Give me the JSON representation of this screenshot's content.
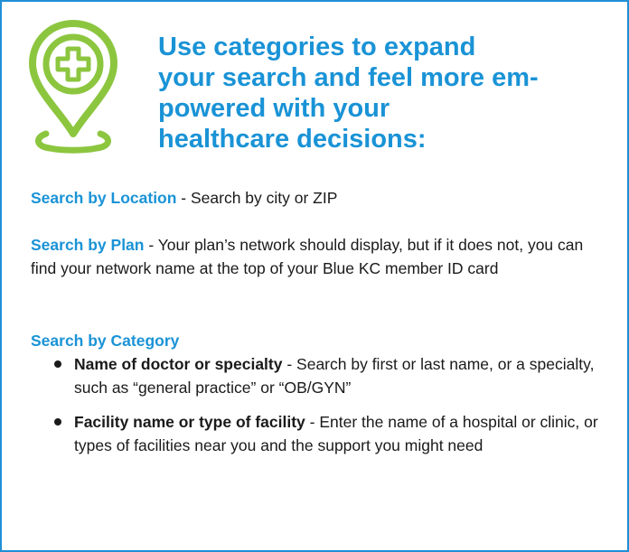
{
  "colors": {
    "accent": "#1a93d6",
    "border": "#1f8fd6",
    "icon": "#8cc63f"
  },
  "icon": "location-pin-medical-cross-icon",
  "headline": {
    "line1": "Use categories to expand",
    "line2": "your search and feel more em-",
    "line3": "powered with your",
    "line4": "healthcare decisions:"
  },
  "location": {
    "label": "Search by Location",
    "text": " - Search by city or ZIP"
  },
  "plan": {
    "label": "Search by Plan",
    "text": " - Your plan’s network should display, but if it does not, you can find your network name at the top of your Blue KC member ID card"
  },
  "category": {
    "label": "Search by Category",
    "items": [
      {
        "title": "Name of doctor or specialty",
        "text": " - Search by first or last name, or a specialty, such as “general practice” or “OB/GYN”"
      },
      {
        "title": "Facility name or type of facility",
        "text": " - Enter the name of a hospital or clinic, or types of facilities near you and the support you might need"
      }
    ]
  }
}
